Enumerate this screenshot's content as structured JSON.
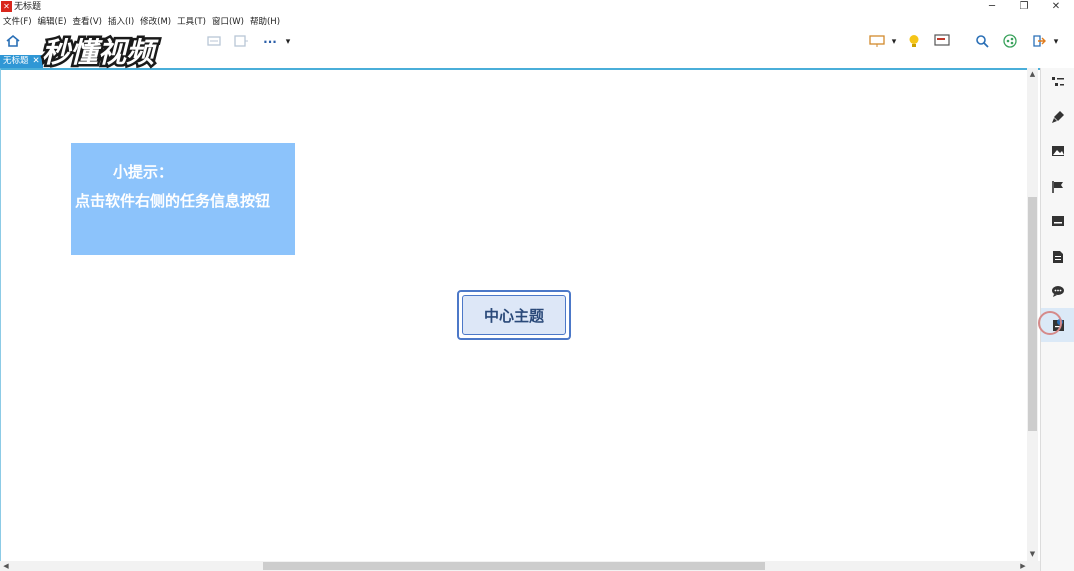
{
  "window": {
    "title": "无标题",
    "controls": {
      "minimize": "─",
      "restore": "❐",
      "close": "✕"
    }
  },
  "menu": [
    {
      "label": "文件(F)"
    },
    {
      "label": "编辑(E)"
    },
    {
      "label": "查看(V)"
    },
    {
      "label": "插入(I)"
    },
    {
      "label": "修改(M)"
    },
    {
      "label": "工具(T)"
    },
    {
      "label": "窗口(W)"
    },
    {
      "label": "帮助(H)"
    }
  ],
  "toolbar": {
    "more_label": "···",
    "dropdown_arrow": "▾"
  },
  "document_tab": {
    "label": "无标题",
    "close": "✕"
  },
  "watermark": {
    "text": "秒懂视频"
  },
  "canvas": {
    "tip": {
      "title": "小提示：",
      "body": "点击软件右侧的任务信息按钮"
    },
    "central_topic": "中心主题"
  },
  "colors": {
    "tab_accent": "#2f97d5",
    "tip_background": "#8cc3fb",
    "topic_border": "#4c78c8"
  }
}
